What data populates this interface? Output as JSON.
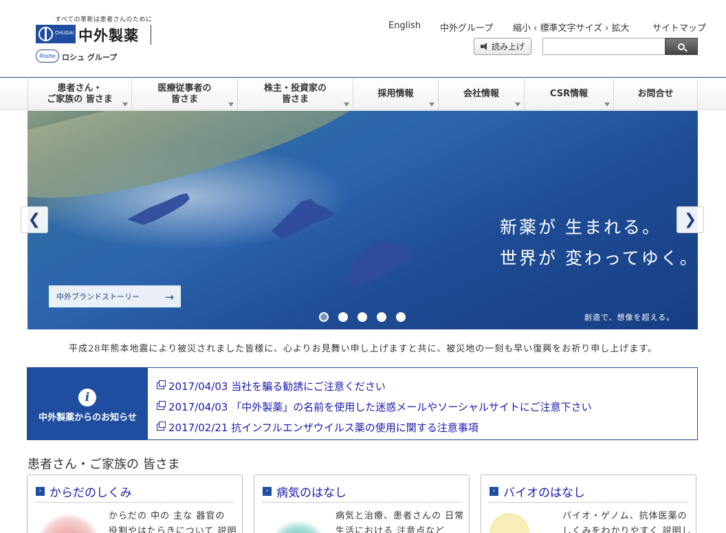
{
  "header": {
    "tagline": "すべての革新は患者さんのために",
    "logo_chugai": "CHUGAI",
    "logo_name": "中外製薬",
    "roche_mark": "Roche",
    "roche_group": "ロシュ グループ",
    "links": {
      "english": "English",
      "group": "中外グループ",
      "text_size": "縮小 ‹ 標準文字サイズ › 拡大",
      "sitemap": "サイトマップ"
    },
    "read_aloud": "読み上げ",
    "search_placeholder": ""
  },
  "nav": {
    "items": [
      {
        "label": "患者さん・\nご家族の 皆さま"
      },
      {
        "label": "医療従事者の\n皆さま"
      },
      {
        "label": "株主・投資家の\n皆さま"
      },
      {
        "label": "採用情報"
      },
      {
        "label": "会社情報"
      },
      {
        "label": "CSR情報"
      },
      {
        "label": "お問合せ"
      }
    ]
  },
  "hero": {
    "line1": "新薬が 生まれる。",
    "line2": "世界が 変わってゆく。",
    "sub": "創造で、想像を超える。",
    "brand_story": "中外ブランドストーリー",
    "brand_arrow": "→",
    "prev": "❮",
    "next": "❯",
    "slides": 5,
    "active_slide": 1
  },
  "condolence": "平成28年熊本地震により被災されました皆様に、心よりお見舞い申し上げますと共に、被災地の一刻も早い復興をお祈り申し上げます。",
  "news": {
    "icon": "i",
    "title": "中外製薬からのお知らせ",
    "items": [
      "2017/04/03 当社を騙る勧誘にご注意ください",
      "2017/04/03 「中外製薬」の名前を使用した迷惑メールやソーシャルサイトにご注意下さい",
      "2017/02/21 抗インフルエンザウイルス薬の使用に関する注意事項"
    ]
  },
  "patients": {
    "title": "患者さん・ご家族の 皆さま",
    "cards": [
      {
        "title": "からだのしくみ",
        "text": "からだの 中の 主な 器官の 役割やはたらきについて 説明"
      },
      {
        "title": "病気のはなし",
        "text": "病気と治療、患者さんの 日常生活における 注意点など"
      },
      {
        "title": "バイオのはなし",
        "text": "バイオ・ゲノム、抗体医薬の しくみをわかりやすく 説明し"
      }
    ]
  },
  "colors": {
    "brand_blue": "#1f4ea1",
    "link_blue": "#1a1ab0"
  }
}
